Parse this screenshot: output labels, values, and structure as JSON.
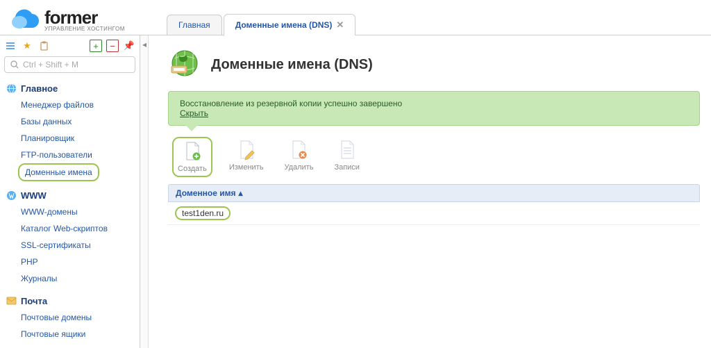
{
  "brand": {
    "name": "former",
    "tagline": "УПРАВЛЕНИЕ ХОСТИНГОМ"
  },
  "tabs": [
    {
      "label": "Главная",
      "active": false,
      "closable": false
    },
    {
      "label": "Доменные имена (DNS)",
      "active": true,
      "closable": true
    }
  ],
  "search": {
    "placeholder": "Ctrl + Shift + M"
  },
  "sidebar": [
    {
      "title": "Главное",
      "icon": "globe",
      "items": [
        {
          "label": "Менеджер файлов"
        },
        {
          "label": "Базы данных"
        },
        {
          "label": "Планировщик"
        },
        {
          "label": "FTP-пользователи"
        },
        {
          "label": "Доменные имена",
          "highlight": true
        }
      ]
    },
    {
      "title": "WWW",
      "icon": "globe",
      "items": [
        {
          "label": "WWW-домены"
        },
        {
          "label": "Каталог Web-скриптов"
        },
        {
          "label": "SSL-сертификаты"
        },
        {
          "label": "PHP"
        },
        {
          "label": "Журналы"
        }
      ]
    },
    {
      "title": "Почта",
      "icon": "mail",
      "items": [
        {
          "label": "Почтовые домены"
        },
        {
          "label": "Почтовые ящики"
        }
      ]
    }
  ],
  "page": {
    "title": "Доменные имена (DNS)"
  },
  "notice": {
    "text": "Восстановление из резервной копии успешно завершено",
    "dismiss": "Скрыть"
  },
  "actions": [
    {
      "label": "Создать",
      "icon": "doc-plus",
      "highlight": true
    },
    {
      "label": "Изменить",
      "icon": "doc-edit"
    },
    {
      "label": "Удалить",
      "icon": "doc-delete"
    },
    {
      "label": "Записи",
      "icon": "doc-list"
    }
  ],
  "table": {
    "column": "Доменное имя",
    "sort": "asc",
    "rows": [
      {
        "domain": "test1den.ru",
        "highlight": true
      }
    ]
  }
}
